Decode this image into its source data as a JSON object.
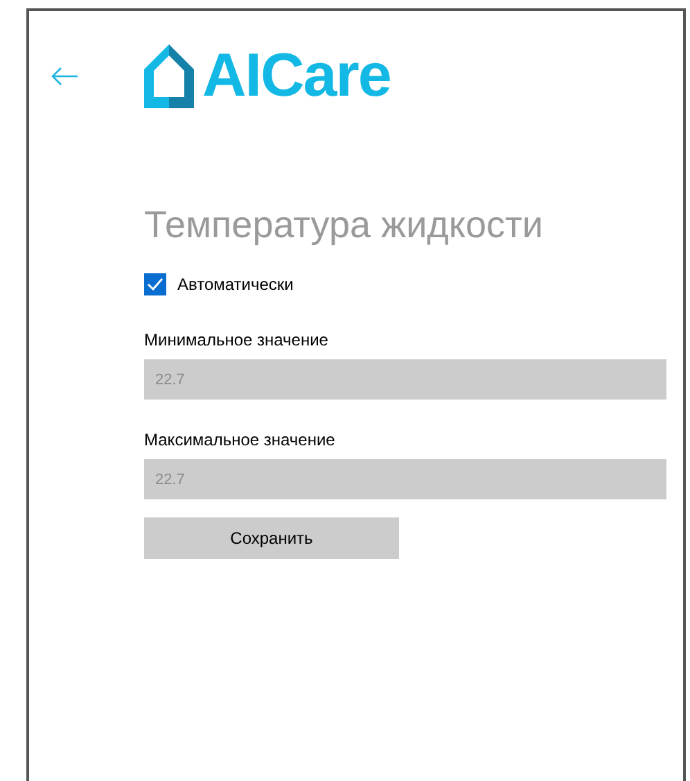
{
  "header": {
    "logo_text": "AICare"
  },
  "title": "Температура жидкости",
  "auto": {
    "label": "Автоматически",
    "checked": true
  },
  "fields": [
    {
      "label": "Минимальное значение",
      "value": "22.7",
      "disabled": true
    },
    {
      "label": "Максимальное значение",
      "value": "22.7",
      "disabled": true
    }
  ],
  "save_button": {
    "label": "Сохранить"
  }
}
